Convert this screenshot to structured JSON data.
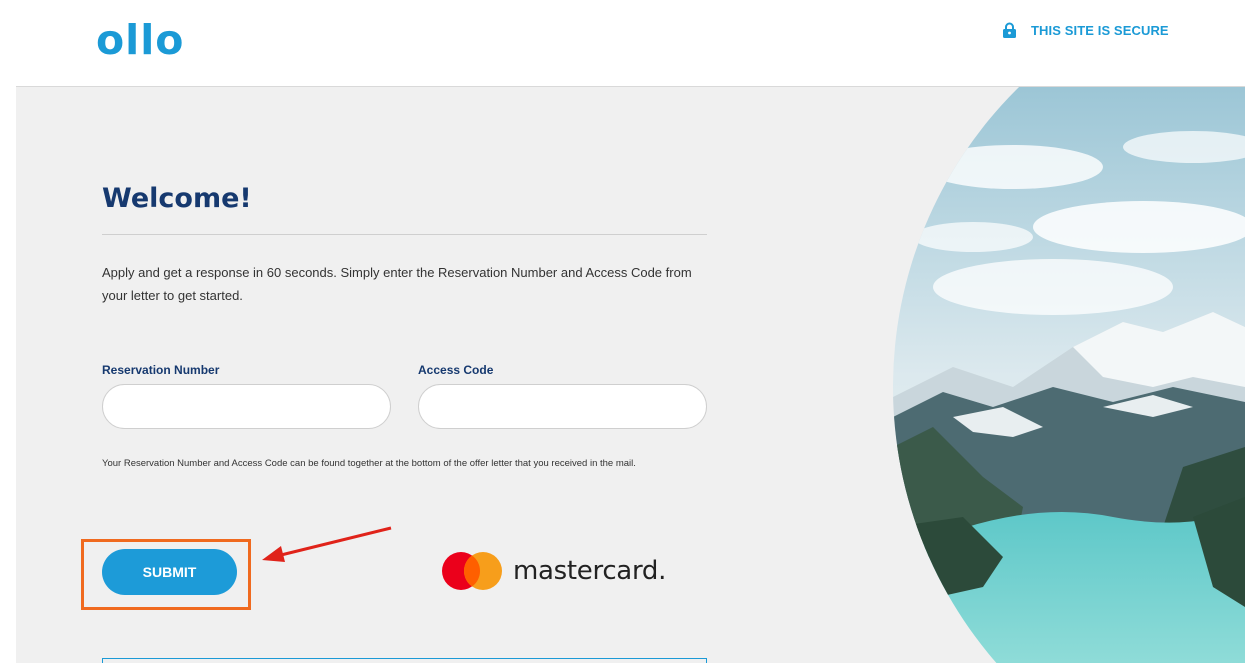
{
  "header": {
    "logo_text": "ollo",
    "secure_label": "THIS SITE IS SECURE"
  },
  "main": {
    "title": "Welcome!",
    "intro": "Apply and get a response in 60 seconds. Simply enter the Reservation Number and Access Code from your letter to get started.",
    "reservation_label": "Reservation Number",
    "reservation_value": "",
    "access_label": "Access Code",
    "access_value": "",
    "hint": "Your Reservation Number and Access Code can be found together at the bottom of the offer letter that you received in the mail.",
    "submit_label": "SUBMIT",
    "mastercard_text": "mastercard."
  },
  "colors": {
    "brand_blue": "#1b9ad6",
    "navy": "#16396f",
    "highlight_orange": "#f06a1f",
    "arrow_red": "#e0231a",
    "mc_red": "#eb001b",
    "mc_yellow": "#f79e1b"
  },
  "icons": {
    "lock": "lock-icon",
    "arrow": "arrow-icon",
    "mastercard_logo": "mastercard-logo"
  }
}
